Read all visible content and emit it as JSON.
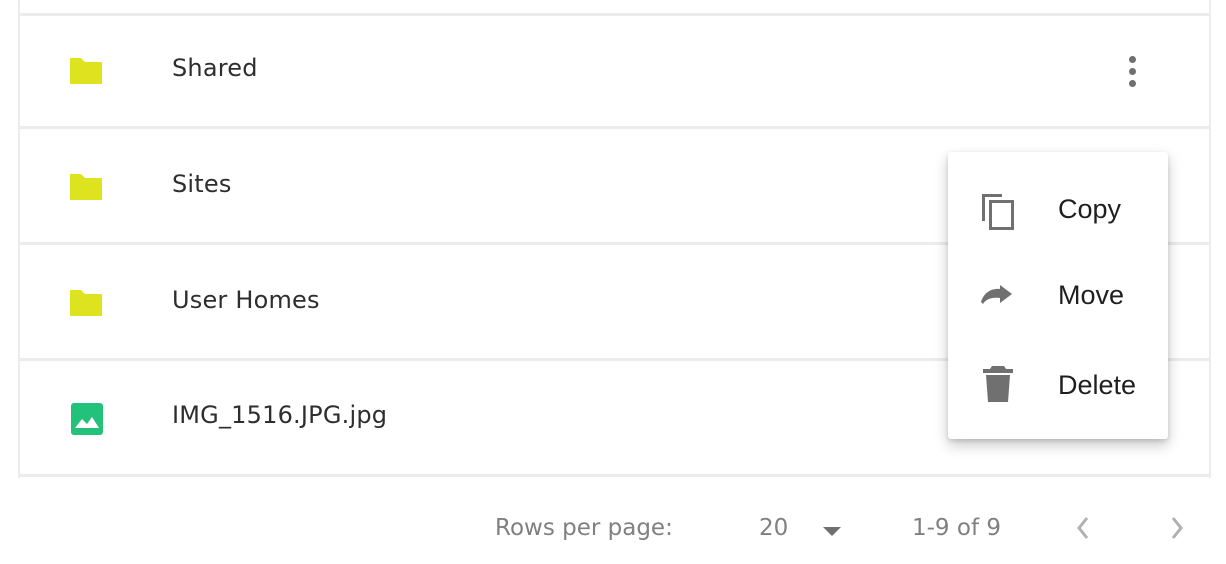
{
  "files": [
    {
      "name": "Shared",
      "icon": "folder-icon",
      "color": "#dde31f"
    },
    {
      "name": "Sites",
      "icon": "folder-icon",
      "color": "#dde31f"
    },
    {
      "name": "User Homes",
      "icon": "folder-icon",
      "color": "#dde31f"
    },
    {
      "name": "IMG_1516.JPG.jpg",
      "icon": "image-icon",
      "color": "#22c27a"
    }
  ],
  "context_menu": {
    "copy_label": "Copy",
    "move_label": "Move",
    "delete_label": "Delete"
  },
  "pagination": {
    "rows_per_page_label": "Rows per page:",
    "rows_per_page_value": "20",
    "range_label": "1-9 of 9"
  }
}
